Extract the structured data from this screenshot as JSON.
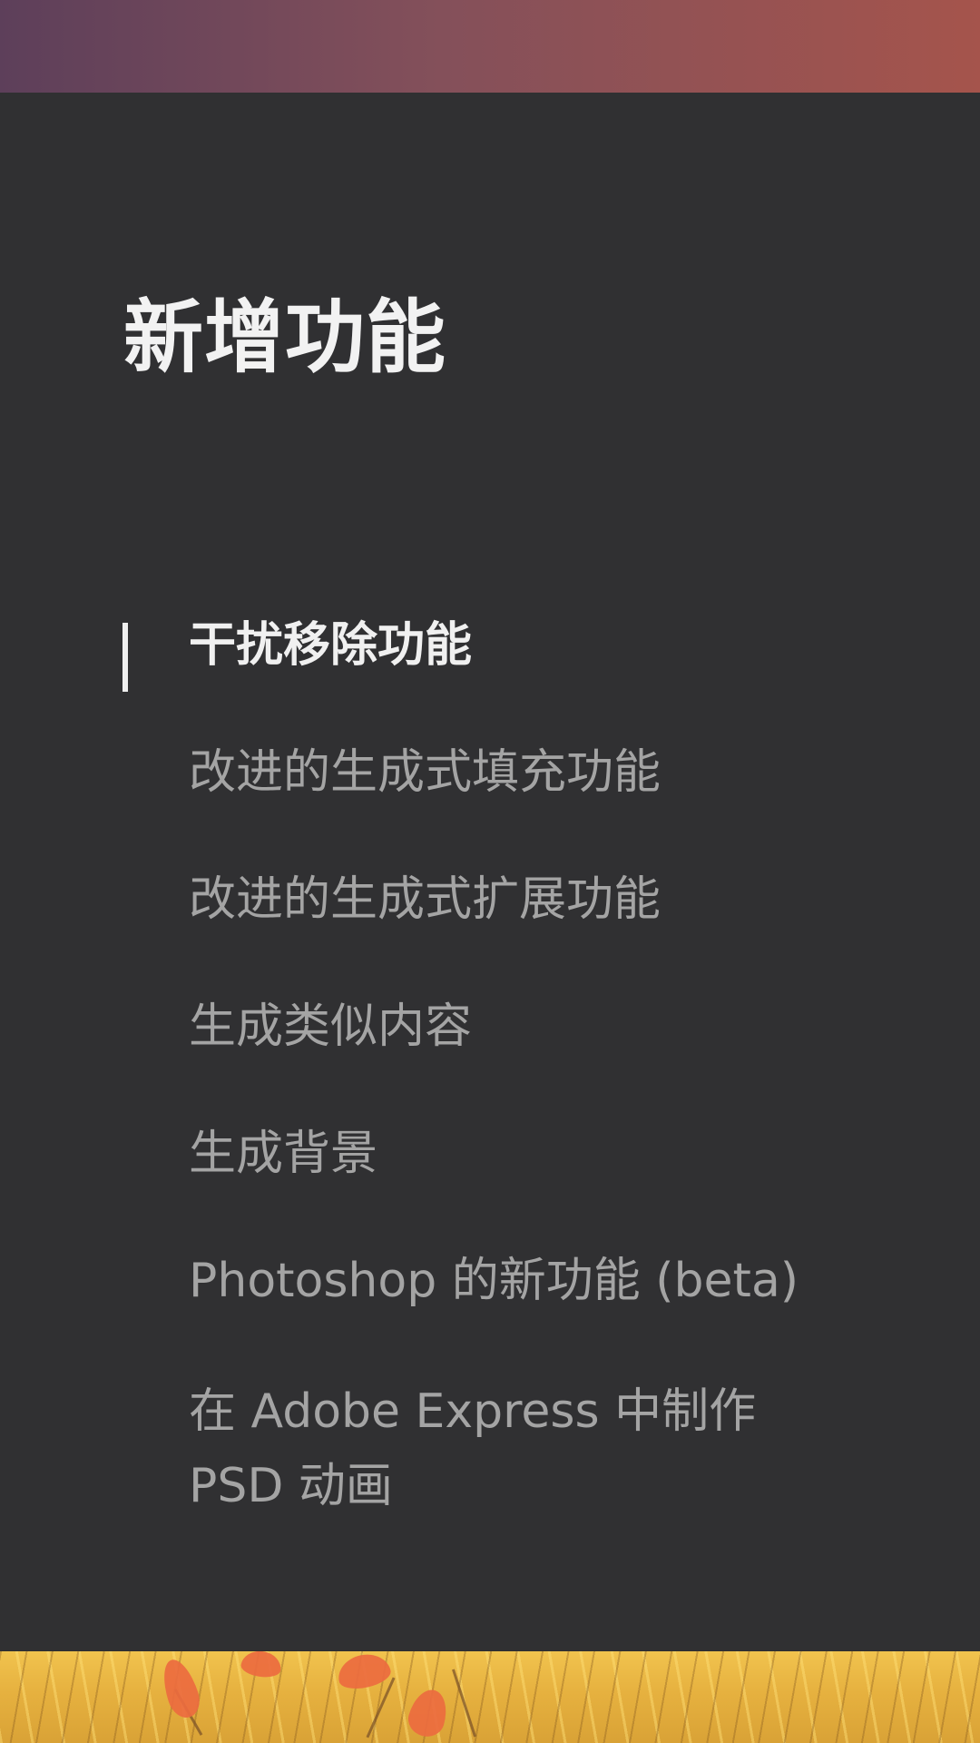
{
  "page": {
    "title": "新增功能"
  },
  "toc": {
    "items": [
      {
        "label": "干扰移除功能"
      },
      {
        "label": "改进的生成式填充功能"
      },
      {
        "label": "改进的生成式扩展功能"
      },
      {
        "label": "生成类似内容"
      },
      {
        "label": "生成背景"
      },
      {
        "label": "Photoshop 的新功能 (beta)"
      },
      {
        "label": "在 Adobe Express 中制作\nPSD 动画"
      }
    ],
    "active_index": 0
  },
  "colors": {
    "background": "#303032",
    "active_text": "#f0f0f0",
    "inactive_text": "#a4a4a4",
    "indicator": "#efefef",
    "top_band_start": "#5d3f5a",
    "top_band_end": "#a5544c",
    "bottom_band": "#e6b13f"
  }
}
